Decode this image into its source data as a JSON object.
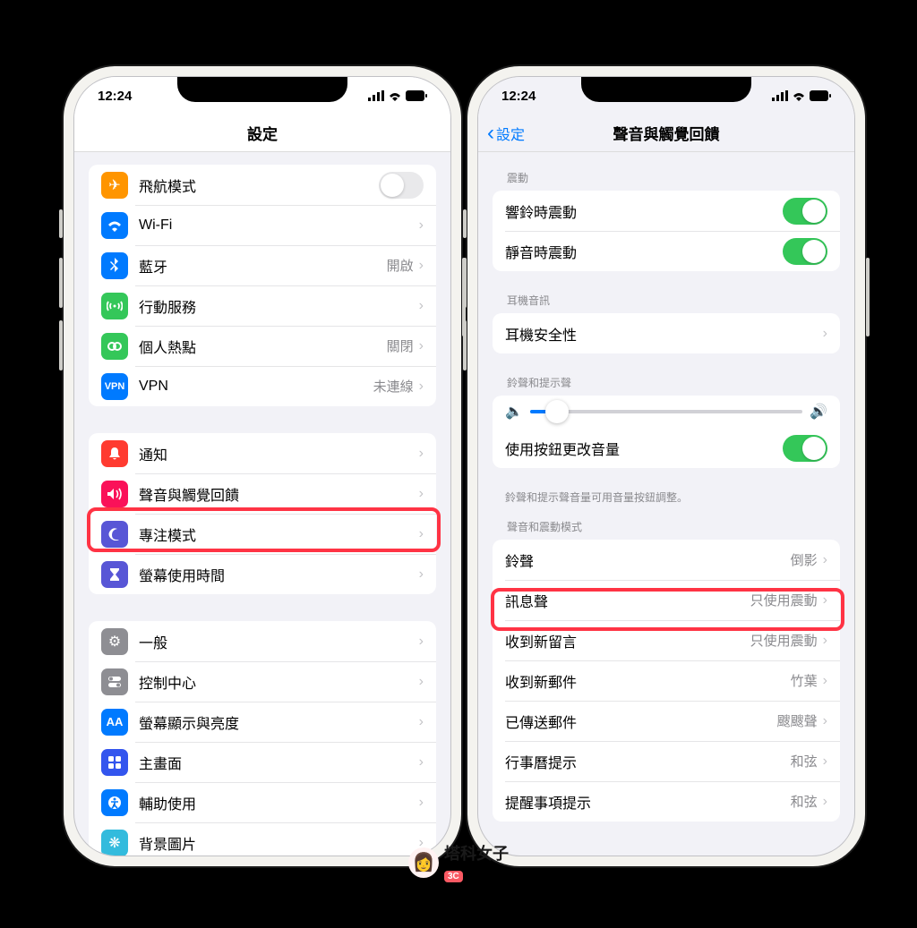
{
  "status_time": "12:24",
  "watermark": "塔科女子",
  "watermark_badge": "3C",
  "left": {
    "title": "設定",
    "g1": [
      {
        "icon": "airplane",
        "color": "#ff9500",
        "label": "飛航模式",
        "toggle": "off"
      },
      {
        "icon": "wifi",
        "color": "#007aff",
        "label": "Wi-Fi",
        "value": ""
      },
      {
        "icon": "bluetooth",
        "color": "#007aff",
        "label": "藍牙",
        "value": "開啟"
      },
      {
        "icon": "cellular",
        "color": "#34c759",
        "label": "行動服務",
        "value": ""
      },
      {
        "icon": "hotspot",
        "color": "#34c759",
        "label": "個人熱點",
        "value": "關閉"
      },
      {
        "icon": "vpn",
        "color": "#007aff",
        "label": "VPN",
        "value": "未連線"
      }
    ],
    "g2": [
      {
        "icon": "bell",
        "color": "#ff3b30",
        "label": "通知"
      },
      {
        "icon": "sound",
        "color": "#fa1159",
        "label": "聲音與觸覺回饋"
      },
      {
        "icon": "moon",
        "color": "#5856d6",
        "label": "專注模式"
      },
      {
        "icon": "hourglass",
        "color": "#5856d6",
        "label": "螢幕使用時間"
      }
    ],
    "g3": [
      {
        "icon": "gear",
        "color": "#8e8e93",
        "label": "一般"
      },
      {
        "icon": "switches",
        "color": "#8e8e93",
        "label": "控制中心"
      },
      {
        "icon": "aa",
        "color": "#007aff",
        "label": "螢幕顯示與亮度"
      },
      {
        "icon": "grid",
        "color": "#3355ee",
        "label": "主畫面"
      },
      {
        "icon": "access",
        "color": "#007aff",
        "label": "輔助使用"
      },
      {
        "icon": "wallpaper",
        "color": "#33bbdd",
        "label": "背景圖片"
      }
    ]
  },
  "right": {
    "back": "設定",
    "title": "聲音與觸覺回饋",
    "sec_vib": "震動",
    "vib": [
      {
        "label": "響鈴時震動",
        "toggle": "on"
      },
      {
        "label": "靜音時震動",
        "toggle": "on"
      }
    ],
    "sec_ear": "耳機音訊",
    "ear": [
      {
        "label": "耳機安全性"
      }
    ],
    "sec_ring": "鈴聲和提示聲",
    "vol_label": "使用按鈕更改音量",
    "vol_foot": "鈴聲和提示聲音量可用音量按鈕調整。",
    "sec_pattern": "聲音和震動模式",
    "patterns": [
      {
        "label": "鈴聲",
        "value": "倒影"
      },
      {
        "label": "訊息聲",
        "value": "只使用震動"
      },
      {
        "label": "收到新留言",
        "value": "只使用震動"
      },
      {
        "label": "收到新郵件",
        "value": "竹葉"
      },
      {
        "label": "已傳送郵件",
        "value": "颼颼聲"
      },
      {
        "label": "行事曆提示",
        "value": "和弦"
      },
      {
        "label": "提醒事項提示",
        "value": "和弦"
      }
    ]
  }
}
